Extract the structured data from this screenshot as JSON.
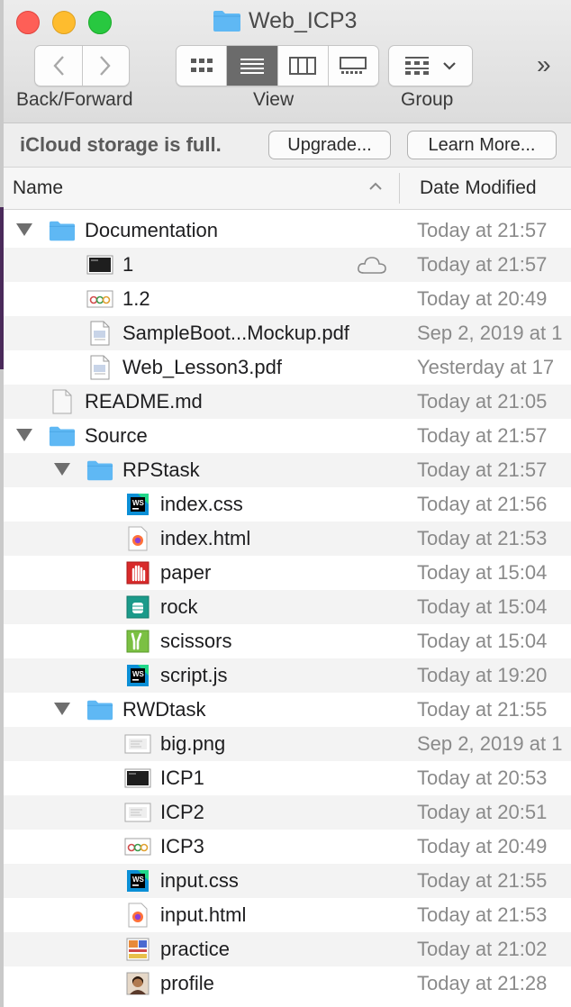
{
  "window": {
    "title": "Web_ICP3"
  },
  "toolbar": {
    "nav_label": "Back/Forward",
    "view_label": "View",
    "group_label": "Group",
    "more_icon": "»"
  },
  "icloud": {
    "message": "iCloud storage is full.",
    "upgrade": "Upgrade...",
    "learn_more": "Learn More..."
  },
  "columns": {
    "name": "Name",
    "date": "Date Modified"
  },
  "rows": [
    {
      "name": "Documentation",
      "date": "Today at 21:57",
      "indent": 0,
      "kind": "folder",
      "expanded": true
    },
    {
      "name": "1",
      "date": "Today at 21:57",
      "indent": 1,
      "kind": "screenshot-dark",
      "cloud": true
    },
    {
      "name": "1.2",
      "date": "Today at 20:49",
      "indent": 1,
      "kind": "thumb-circles"
    },
    {
      "name": "SampleBoot...Mockup.pdf",
      "date": "Sep 2, 2019 at 1",
      "indent": 1,
      "kind": "pdf"
    },
    {
      "name": "Web_Lesson3.pdf",
      "date": "Yesterday at 17",
      "indent": 1,
      "kind": "pdf"
    },
    {
      "name": "README.md",
      "date": "Today at 21:05",
      "indent": 0,
      "kind": "doc"
    },
    {
      "name": "Source",
      "date": "Today at 21:57",
      "indent": 0,
      "kind": "folder",
      "expanded": true
    },
    {
      "name": "RPStask",
      "date": "Today at 21:57",
      "indent": 1,
      "kind": "folder",
      "expanded": true
    },
    {
      "name": "index.css",
      "date": "Today at 21:56",
      "indent": 2,
      "kind": "ws"
    },
    {
      "name": "index.html",
      "date": "Today at 21:53",
      "indent": 2,
      "kind": "firefox"
    },
    {
      "name": "paper",
      "date": "Today at 15:04",
      "indent": 2,
      "kind": "paper"
    },
    {
      "name": "rock",
      "date": "Today at 15:04",
      "indent": 2,
      "kind": "rock"
    },
    {
      "name": "scissors",
      "date": "Today at 15:04",
      "indent": 2,
      "kind": "scissors"
    },
    {
      "name": "script.js",
      "date": "Today at 19:20",
      "indent": 2,
      "kind": "ws"
    },
    {
      "name": "RWDtask",
      "date": "Today at 21:55",
      "indent": 1,
      "kind": "folder",
      "expanded": true
    },
    {
      "name": "big.png",
      "date": "Sep 2, 2019 at 1",
      "indent": 2,
      "kind": "thumb-light"
    },
    {
      "name": "ICP1",
      "date": "Today at 20:53",
      "indent": 2,
      "kind": "screenshot-dark"
    },
    {
      "name": "ICP2",
      "date": "Today at 20:51",
      "indent": 2,
      "kind": "thumb-light"
    },
    {
      "name": "ICP3",
      "date": "Today at 20:49",
      "indent": 2,
      "kind": "thumb-circles"
    },
    {
      "name": "input.css",
      "date": "Today at 21:55",
      "indent": 2,
      "kind": "ws"
    },
    {
      "name": "input.html",
      "date": "Today at 21:53",
      "indent": 2,
      "kind": "firefox"
    },
    {
      "name": "practice",
      "date": "Today at 21:02",
      "indent": 2,
      "kind": "thumb-color"
    },
    {
      "name": "profile",
      "date": "Today at 21:28",
      "indent": 2,
      "kind": "avatar"
    }
  ],
  "colors": {
    "folder": "#5fb8f4",
    "close": "#fe5f57",
    "minimize": "#febc2e",
    "zoom": "#28c840",
    "ws_blue": "#0b8fd6",
    "ws_green": "#21d789",
    "paper_red": "#d82a2a",
    "rock_teal": "#1b9a8a",
    "scissors_green": "#7bc043"
  }
}
